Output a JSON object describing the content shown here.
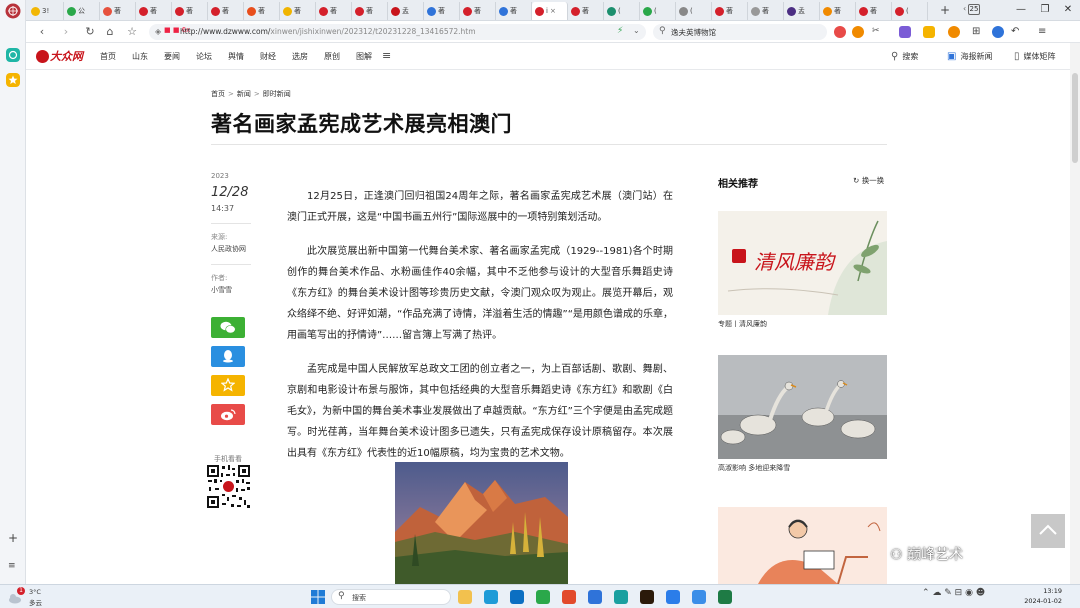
{
  "browser": {
    "tabs": [
      {
        "label": "3!",
        "color": "#f2b705",
        "active": false
      },
      {
        "label": "公",
        "color": "#2aa84a",
        "active": false
      },
      {
        "label": "著",
        "color": "#e6513d",
        "active": false
      },
      {
        "label": "著",
        "color": "#d4202b",
        "active": false
      },
      {
        "label": "著",
        "color": "#d4202b",
        "active": false
      },
      {
        "label": "著",
        "color": "#d4202b",
        "active": false
      },
      {
        "label": "著",
        "color": "#e84e1c",
        "active": false
      },
      {
        "label": "著",
        "color": "#f0b400",
        "active": false
      },
      {
        "label": "著",
        "color": "#d4202b",
        "active": false
      },
      {
        "label": "著",
        "color": "#d4202b",
        "active": false
      },
      {
        "label": "孟",
        "color": "#c8141b",
        "active": false
      },
      {
        "label": "著",
        "color": "#2f73d9",
        "active": false
      },
      {
        "label": "著",
        "color": "#d4202b",
        "active": false
      },
      {
        "label": "著",
        "color": "#2f73d9",
        "active": false
      },
      {
        "label": "i",
        "color": "#d4202b",
        "active": true
      },
      {
        "label": "著",
        "color": "#d4202b",
        "active": false
      },
      {
        "label": "(",
        "color": "#1c8f6e",
        "active": false
      },
      {
        "label": "(",
        "color": "#2aa84a",
        "active": false
      },
      {
        "label": "(",
        "color": "#888888",
        "active": false
      },
      {
        "label": "著",
        "color": "#d4202b",
        "active": false
      },
      {
        "label": "著",
        "color": "#999999",
        "active": false
      },
      {
        "label": "孟",
        "color": "#4b2e83",
        "active": false
      },
      {
        "label": "著",
        "color": "#f08a00",
        "active": false
      },
      {
        "label": "著",
        "color": "#d4202b",
        "active": false
      },
      {
        "label": "(",
        "color": "#d4202b",
        "active": false
      }
    ],
    "new_tab_glyph": "+",
    "tab_count": "25",
    "window_controls": {
      "minimize": "—",
      "restore": "❐",
      "close": "✕"
    },
    "url": "http://www.dzwww.com/",
    "url_path": "xinwen/jishixinwen/202312/t20231228_13416572.htm",
    "url_prefix_icons": "■ ■ 6x",
    "search_placeholder": "逸夫英博物馆"
  },
  "site": {
    "logo_text": "大众网",
    "nav": [
      "首页",
      "山东",
      "要闻",
      "论坛",
      "舆情",
      "财经",
      "选房",
      "原创",
      "图解"
    ],
    "header_search": "搜索",
    "header_poster": "海报新闻",
    "header_media": "媒体矩阵"
  },
  "article": {
    "breadcrumb": [
      "首页",
      "新闻",
      "即时新闻"
    ],
    "breadcrumb_sep": ">",
    "title": "著名画家孟宪成艺术展亮相澳门",
    "meta": {
      "year": "2023",
      "date": "12/28",
      "time": "14:37",
      "source_label": "来源:",
      "source": "人民政协网",
      "author_label": "作者:",
      "author": "小雪雪"
    },
    "share_colors": {
      "wechat": "#3cb034",
      "qq": "#2a8fe0",
      "favorite": "#f5b400",
      "weibo": "#e84b48"
    },
    "qr_label": "手机看看",
    "paragraphs": [
      "12月25日，正逢澳门回归祖国24周年之际，著名画家孟宪成艺术展（澳门站）在澳门正式开展，这是“中国书画五州行”国际巡展中的一项特别策划活动。",
      "此次展览展出新中国第一代舞台美术家、著名画家孟宪成（1929--1981)各个时期创作的舞台美术作品、水粉画佳作40余幅，其中不乏他参与设计的大型音乐舞蹈史诗《东方红》的舞台美术设计图等珍贵历史文献，令澳门观众叹为观止。展览开幕后，观众络绎不绝、好评如潮，“作品充满了诗情，洋溢着生活的情趣”“是用颜色谱成的乐章，用画笔写出的抒情诗”……留言簿上写满了热评。",
      "孟宪成是中国人民解放军总政文工团的创立者之一，为上百部话剧、歌剧、舞剧、京剧和电影设计布景与服饰，其中包括经典的大型音乐舞蹈史诗《东方红》和歌剧《白毛女》，为新中国的舞台美术事业发展做出了卓越贡献。“东方红”三个字便是由孟宪成题写。时光荏苒，当年舞台美术设计图多已遗失，只有孟宪成保存设计原稿留存。本次展出具有《东方红》代表性的近10幅原稿，均为宝贵的艺术文物。"
    ]
  },
  "sidebar": {
    "title": "相关推荐",
    "refresh": "换一换",
    "cards": [
      {
        "caption": "专题丨清风廉韵",
        "banner_text": "清风廉韵"
      },
      {
        "caption": "高淑影响 多地迎来降雪"
      },
      {
        "caption": ""
      }
    ]
  },
  "watermark": "巅峰艺术",
  "taskbar": {
    "weather_badge": "1",
    "weather_temp": "3°C",
    "weather_desc": "多云",
    "search_label": "搜索",
    "apps": [
      {
        "name": "file-explorer",
        "color": "#f2c14e"
      },
      {
        "name": "edge-browser",
        "color": "#1e9bd7"
      },
      {
        "name": "mail",
        "color": "#0b6fc2"
      },
      {
        "name": "wechat",
        "color": "#2aa84a"
      },
      {
        "name": "sogou",
        "color": "#e24a2b"
      },
      {
        "name": "qq-browser",
        "color": "#2f73d9"
      },
      {
        "name": "photos",
        "color": "#1aa0a0"
      },
      {
        "name": "illustrator",
        "color": "#2b1a0a"
      },
      {
        "name": "baidu-netdisk",
        "color": "#2b7de9"
      },
      {
        "name": "wechat-work",
        "color": "#3b8ee8"
      },
      {
        "name": "excel",
        "color": "#1e7b45"
      }
    ],
    "tray_text": "⌃ ☁ ✎ ⊟ ◉ ☻",
    "time": "13:19",
    "date": "2024-01-02"
  }
}
